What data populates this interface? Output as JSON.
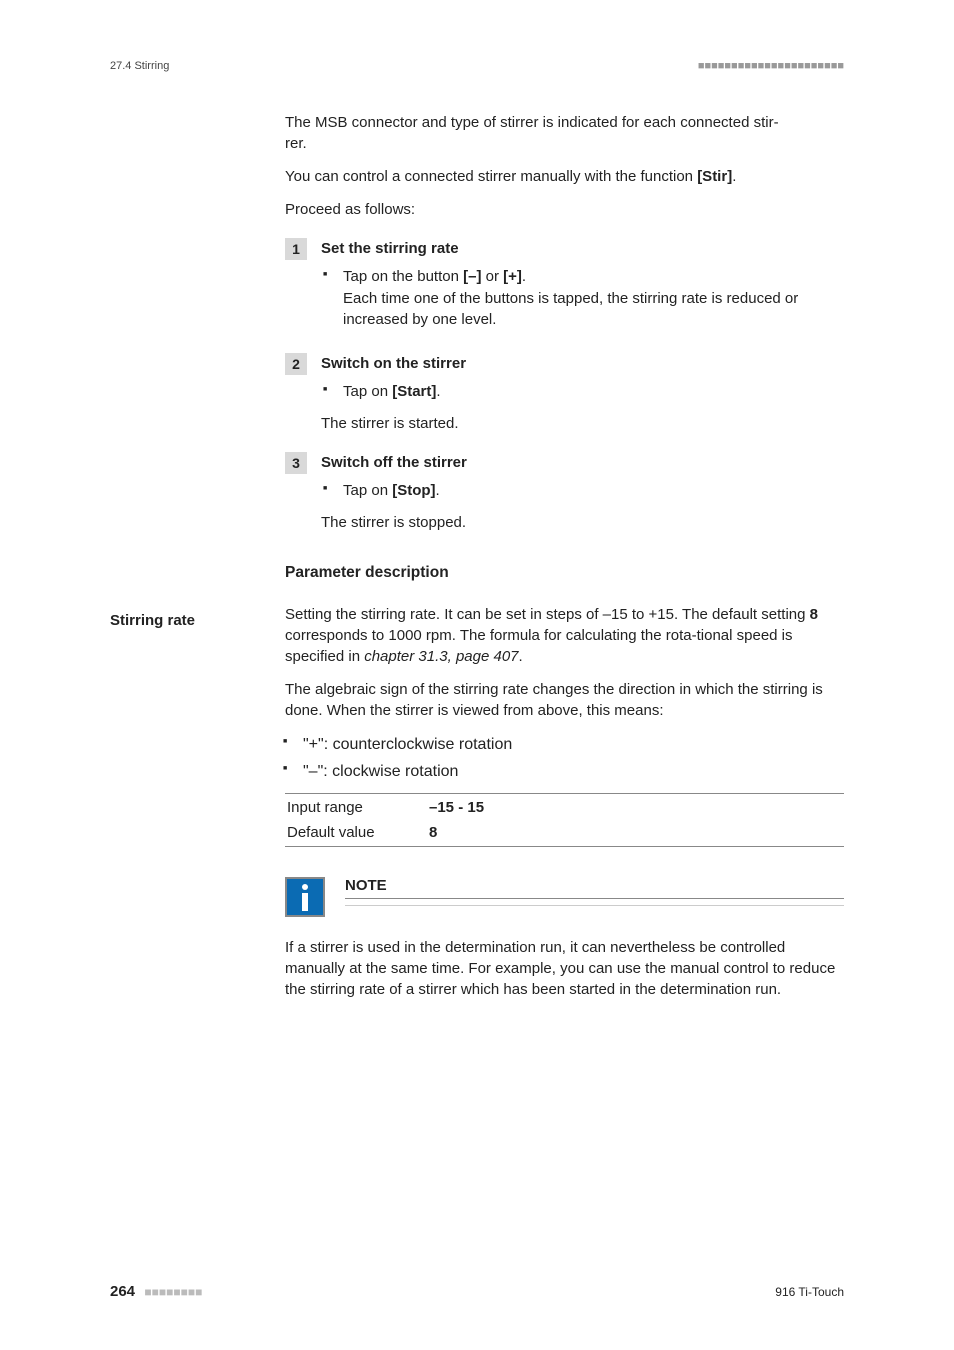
{
  "header": {
    "left": "27.4 Stirring",
    "right_dots": "■■■■■■■■■■■■■■■■■■■■■■"
  },
  "intro": {
    "p1_a": "The MSB connector and type of stirrer is indicated for each connected stir",
    "p1_b": "rer.",
    "p2_a": "You can control a connected stirrer manually with the function ",
    "p2_b": "[Stir]",
    "p2_c": ".",
    "p3": "Proceed as follows:"
  },
  "steps": [
    {
      "num": "1",
      "title": "Set the stirring rate",
      "bullet_a": "Tap on the button ",
      "bullet_b": "[–]",
      "bullet_c": " or ",
      "bullet_d": "[+]",
      "bullet_e": ".",
      "bullet_line2": "Each time one of the buttons is tapped, the stirring rate is reduced or increased by one level."
    },
    {
      "num": "2",
      "title": "Switch on the stirrer",
      "bullet_a": "Tap on ",
      "bullet_b": "[Start]",
      "bullet_c": ".",
      "follow": "The stirrer is started."
    },
    {
      "num": "3",
      "title": "Switch off the stirrer",
      "bullet_a": "Tap on ",
      "bullet_b": "[Stop]",
      "bullet_c": ".",
      "follow": "The stirrer is stopped."
    }
  ],
  "param_section_heading": "Parameter description",
  "side_label": "Stirring rate",
  "param_desc": {
    "p1_a": "Setting the stirring rate. It can be set in steps of –15 to +15. The default setting ",
    "p1_b": "8",
    "p1_c": " corresponds to 1000 rpm. The formula for calculating the rota",
    "p1_d": "tional speed is specified in ",
    "p1_e": "chapter 31.3, page 407",
    "p1_f": ".",
    "p2": "The algebraic sign of the stirring rate changes the direction in which the stirring is done. When the stirrer is viewed from above, this means:",
    "li1": "\"+\": counterclockwise rotation",
    "li2": "\"–\": clockwise rotation"
  },
  "param_table": {
    "row1_label": "Input range",
    "row1_value": "–15 - 15",
    "row2_label": "Default value",
    "row2_value": "8"
  },
  "note": {
    "title": "NOTE",
    "body": "If a stirrer is used in the determination run, it can nevertheless be controlled manually at the same time. For example, you can use the manual control to reduce the stirring rate of a stirrer which has been started in the determination run."
  },
  "footer": {
    "page_num": "264",
    "left_dots": "■■■■■■■■",
    "product": "916 Ti-Touch"
  }
}
